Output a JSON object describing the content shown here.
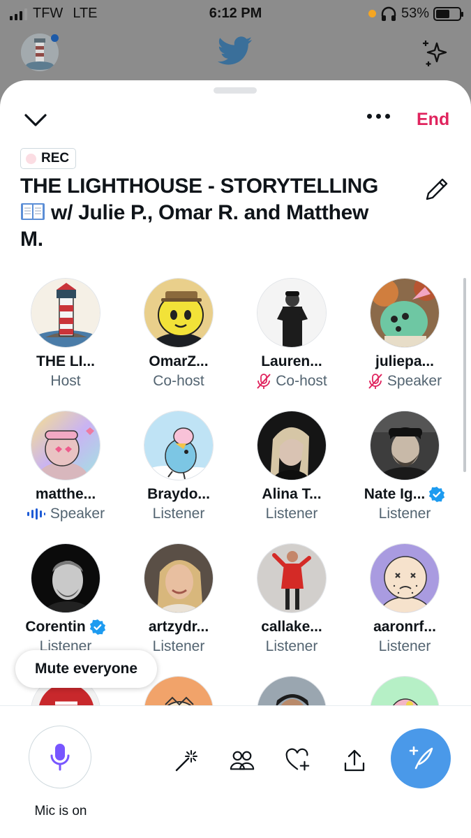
{
  "status_bar": {
    "carrier": "TFW",
    "network": "LTE",
    "time": "6:12 PM",
    "battery": "53%"
  },
  "sheet": {
    "end_label": "End",
    "rec_label": "REC",
    "title_line1": "THE LIGHTHOUSE - STORYTELLING",
    "title_line2": "w/ Julie P., Omar R. and Matthew",
    "title_line3": "M."
  },
  "participants": [
    {
      "name": "THE LI...",
      "role": "Host",
      "muted": false,
      "verified": false,
      "speaking": false,
      "avatar": "lighthouse"
    },
    {
      "name": "OmarZ...",
      "role": "Co-host",
      "muted": false,
      "verified": false,
      "speaking": false,
      "avatar": "yellow-cartoon"
    },
    {
      "name": "Lauren...",
      "role": "Co-host",
      "muted": true,
      "verified": false,
      "speaking": false,
      "avatar": "man-bw"
    },
    {
      "name": "juliepa...",
      "role": "Speaker",
      "muted": true,
      "verified": false,
      "speaking": false,
      "avatar": "green-creature"
    },
    {
      "name": "matthe...",
      "role": "Speaker",
      "muted": false,
      "verified": false,
      "speaking": true,
      "avatar": "pastel-guy"
    },
    {
      "name": "Braydo...",
      "role": "Listener",
      "muted": false,
      "verified": false,
      "speaking": false,
      "avatar": "blue-bird"
    },
    {
      "name": "Alina T...",
      "role": "Listener",
      "muted": false,
      "verified": false,
      "speaking": false,
      "avatar": "woman-portrait"
    },
    {
      "name": "Nate Ig...",
      "role": "Listener",
      "muted": false,
      "verified": true,
      "speaking": false,
      "avatar": "bearded-man"
    },
    {
      "name": "Corentin",
      "role": "Listener",
      "muted": false,
      "verified": true,
      "speaking": false,
      "avatar": "man-dark"
    },
    {
      "name": "artzydr...",
      "role": "Listener",
      "muted": false,
      "verified": false,
      "speaking": false,
      "avatar": "blonde-woman"
    },
    {
      "name": "callake...",
      "role": "Listener",
      "muted": false,
      "verified": false,
      "speaking": false,
      "avatar": "red-dress"
    },
    {
      "name": "aaronrf...",
      "role": "Listener",
      "muted": false,
      "verified": false,
      "speaking": false,
      "avatar": "bald-cartoon"
    }
  ],
  "mute_everyone_label": "Mute everyone",
  "bottom": {
    "mic_label": "Mic is on"
  },
  "colors": {
    "accent": "#1d9bf0",
    "end_red": "#e0245e",
    "mic_purple": "#7856ff",
    "muted_pink": "#e0245e",
    "compose_blue": "#4a99e9"
  }
}
